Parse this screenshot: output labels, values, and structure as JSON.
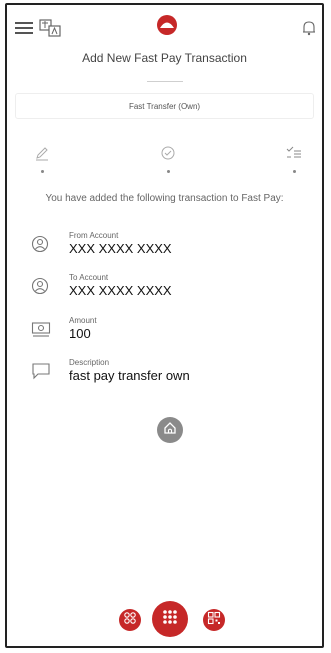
{
  "header": {
    "title": "Add New Fast Pay Transaction",
    "subtitle": "Fast Transfer (Own)"
  },
  "message": "You have added the following transaction to Fast Pay:",
  "details": [
    {
      "label": "From Account",
      "value": "XXX XXXX XXXX",
      "icon": "user-circle-icon"
    },
    {
      "label": "To Account",
      "value": "XXX XXXX XXXX",
      "icon": "user-circle-icon"
    },
    {
      "label": "Amount",
      "value": "100",
      "icon": "money-icon"
    },
    {
      "label": "Description",
      "value": "fast pay transfer own",
      "icon": "chat-bubble-icon"
    }
  ],
  "colors": {
    "brand": "#c62828",
    "muted": "#8a8a8a"
  },
  "icons": {
    "menu": "hamburger-menu-icon",
    "language": "translate-icon",
    "logo": "brand-logo",
    "notifications": "bell-icon",
    "step1": "pencil-icon",
    "step2": "check-badge-icon",
    "step3": "list-check-icon",
    "home": "home-icon",
    "nav_left": "apps-icon",
    "nav_center": "grid-menu-icon",
    "nav_right": "qr-code-icon"
  }
}
